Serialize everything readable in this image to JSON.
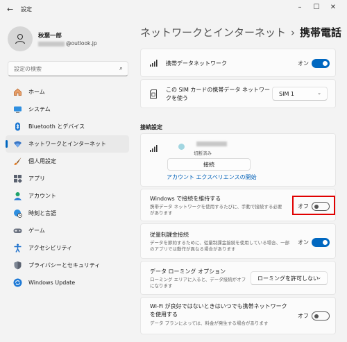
{
  "window": {
    "title": "設定",
    "controls": [
      "minimize-icon",
      "maximize-icon",
      "close-icon"
    ]
  },
  "profile": {
    "name": "秋葉一郎",
    "email_suffix": "@outlook.jp"
  },
  "search": {
    "placeholder": "設定の検索"
  },
  "sidebar": {
    "items": [
      {
        "label": "ホーム",
        "icon": "home-icon"
      },
      {
        "label": "システム",
        "icon": "system-icon"
      },
      {
        "label": "Bluetooth とデバイス",
        "icon": "bluetooth-icon"
      },
      {
        "label": "ネットワークとインターネット",
        "icon": "wifi-icon",
        "active": true
      },
      {
        "label": "個人用設定",
        "icon": "brush-icon"
      },
      {
        "label": "アプリ",
        "icon": "apps-icon"
      },
      {
        "label": "アカウント",
        "icon": "account-icon"
      },
      {
        "label": "時刻と言語",
        "icon": "globe-clock-icon"
      },
      {
        "label": "ゲーム",
        "icon": "gamepad-icon"
      },
      {
        "label": "アクセシビリティ",
        "icon": "accessibility-icon"
      },
      {
        "label": "プライバシーとセキュリティ",
        "icon": "shield-icon"
      },
      {
        "label": "Windows Update",
        "icon": "update-icon"
      }
    ]
  },
  "breadcrumb": {
    "parent": "ネットワークとインターネット",
    "separator": "›",
    "current": "携帯電話"
  },
  "cellular_data": {
    "label": "携帯データネットワーク",
    "state": "オン",
    "enabled": true
  },
  "sim_select": {
    "label": "この SIM カードの携帯データ ネットワークを使う",
    "value": "SIM 1"
  },
  "connection_section": {
    "title": "接続設定",
    "status": "切断済み",
    "connect_button": "接続",
    "experience_link": "アカウント エクスペリエンスの開始"
  },
  "keep_connected": {
    "label": "Windows で接続を維持する",
    "description": "携帯データ ネットワークを使用するたびに、手動で接続する必要があります",
    "state": "オフ",
    "enabled": false
  },
  "metered": {
    "label": "従量制課金接続",
    "description": "データを節約するために、従量制課金接続を使用している場合、一部のアプリでは動作が異なる場合があります",
    "state": "オン",
    "enabled": true
  },
  "roaming": {
    "label": "データ ローミング オプション",
    "description": "ローミング エリアに入ると、データ接続がオフになります",
    "value": "ローミングを許可しない"
  },
  "wifi_fallback": {
    "label": "Wi-Fi が良好ではないときはいつでも携帯ネットワークを使用する",
    "description": "データ プランによっては、料金が発生する場合があります",
    "state": "オフ",
    "enabled": false
  },
  "colors": {
    "accent": "#0067c0",
    "highlight": "#e00000"
  }
}
